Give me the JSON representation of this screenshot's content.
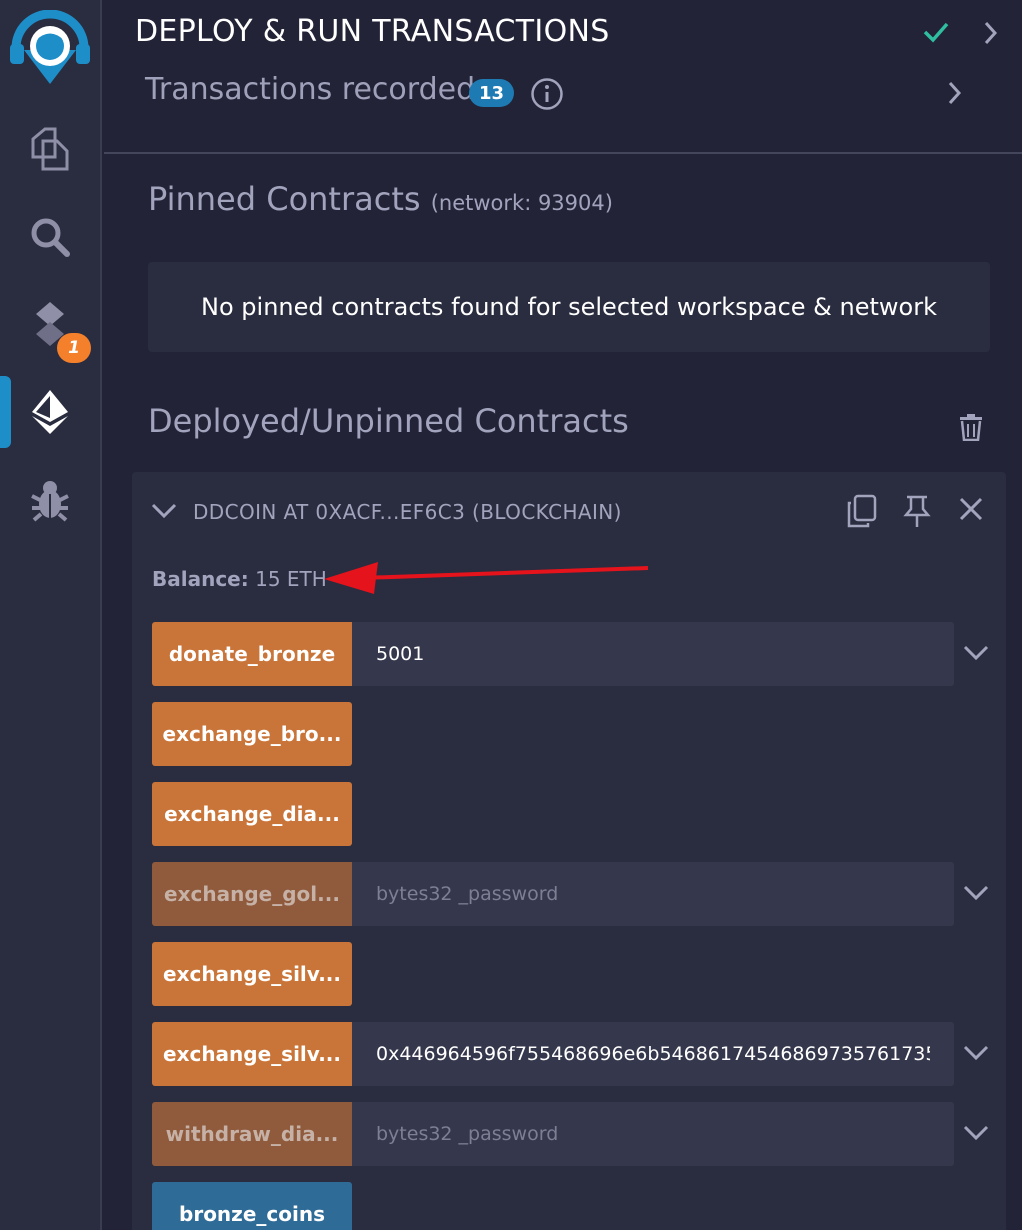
{
  "rail": {
    "items": [
      {
        "name": "remix-logo"
      },
      {
        "name": "file-explorer-icon"
      },
      {
        "name": "search-icon"
      },
      {
        "name": "solidity-compiler-icon",
        "badge": "1"
      },
      {
        "name": "deploy-run-icon",
        "active": true
      },
      {
        "name": "debugger-icon"
      }
    ]
  },
  "header": {
    "title": "DEPLOY & RUN TRANSACTIONS",
    "transactions_label": "Transactions recorded",
    "transactions_count": "13"
  },
  "pinned": {
    "title": "Pinned Contracts",
    "network": "(network: 93904)",
    "empty_message": "No pinned contracts found for selected workspace & network"
  },
  "deployed": {
    "title": "Deployed/Unpinned Contracts",
    "instance": {
      "title": "DDCOIN AT 0XACF...EF6C3 (BLOCKCHAIN)",
      "balance_label": "Balance:",
      "balance_value": "15 ETH",
      "functions": [
        {
          "label": "donate_bronze",
          "kind": "transact",
          "value": "5001",
          "placeholder": ""
        },
        {
          "label": "exchange_bro...",
          "kind": "transact"
        },
        {
          "label": "exchange_dia...",
          "kind": "transact"
        },
        {
          "label": "exchange_gol...",
          "kind": "disabled",
          "value": "",
          "placeholder": "bytes32 _password"
        },
        {
          "label": "exchange_silv...",
          "kind": "transact"
        },
        {
          "label": "exchange_silv...",
          "kind": "transact",
          "value": "0x446964596f755468696e6b546861745468697357617354686",
          "placeholder": ""
        },
        {
          "label": "withdraw_dia...",
          "kind": "disabled",
          "value": "",
          "placeholder": "bytes32 _password"
        },
        {
          "label": "bronze_coins",
          "kind": "call"
        }
      ]
    }
  },
  "colors": {
    "accent_orange": "#c97539",
    "accent_blue": "#1e7ab2",
    "annotation_arrow": "#e5131b",
    "check_green": "#2fbfa0"
  }
}
